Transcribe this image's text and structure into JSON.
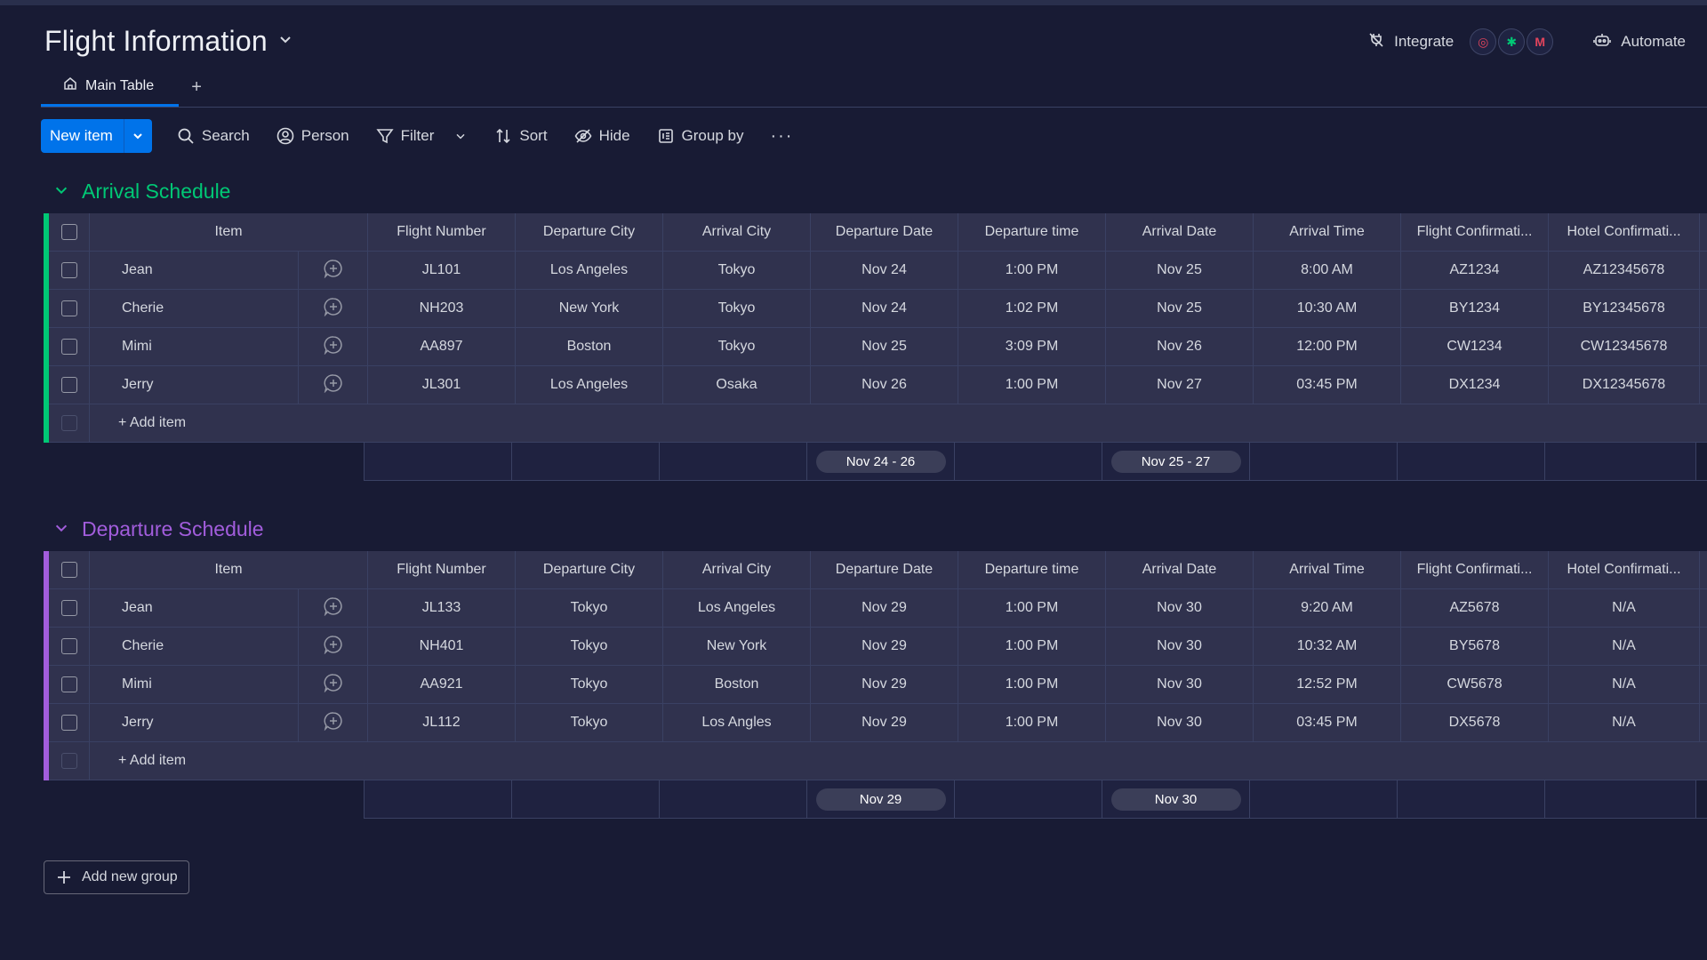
{
  "board": {
    "title": "Flight Information"
  },
  "header": {
    "integrate_label": "Integrate",
    "integrations": [
      {
        "icon": "integration-a-icon",
        "color": "#e2445c"
      },
      {
        "icon": "slack-icon",
        "color": "#00c875"
      },
      {
        "icon": "gmail-icon",
        "color": "#e2445c"
      }
    ],
    "automate_label": "Automate"
  },
  "tabs": [
    {
      "label": "Main Table",
      "active": true
    }
  ],
  "toolbar": {
    "new_item": "New item",
    "search": "Search",
    "person": "Person",
    "filter": "Filter",
    "sort": "Sort",
    "hide": "Hide",
    "group_by": "Group by"
  },
  "columns": [
    "Item",
    "Flight Number",
    "Departure City",
    "Arrival City",
    "Departure Date",
    "Departure time",
    "Arrival Date",
    "Arrival Time",
    "Flight Confirmati...",
    "Hotel Confirmati..."
  ],
  "add_item_label": "+ Add item",
  "groups": [
    {
      "title": "Arrival Schedule",
      "color": "#00c875",
      "rows": [
        {
          "item": "Jean",
          "flight": "JL101",
          "dep_city": "Los Angeles",
          "arr_city": "Tokyo",
          "dep_date": "Nov 24",
          "dep_time": "1:00 PM",
          "arr_date": "Nov 25",
          "arr_time": "8:00 AM",
          "flight_conf": "AZ1234",
          "hotel_conf": "AZ12345678"
        },
        {
          "item": "Cherie",
          "flight": "NH203",
          "dep_city": "New York",
          "arr_city": "Tokyo",
          "dep_date": "Nov 24",
          "dep_time": "1:02 PM",
          "arr_date": "Nov 25",
          "arr_time": "10:30 AM",
          "flight_conf": "BY1234",
          "hotel_conf": "BY12345678"
        },
        {
          "item": "Mimi",
          "flight": "AA897",
          "dep_city": "Boston",
          "arr_city": "Tokyo",
          "dep_date": "Nov 25",
          "dep_time": "3:09 PM",
          "arr_date": "Nov 26",
          "arr_time": "12:00 PM",
          "flight_conf": "CW1234",
          "hotel_conf": "CW12345678"
        },
        {
          "item": "Jerry",
          "flight": "JL301",
          "dep_city": "Los Angeles",
          "arr_city": "Osaka",
          "dep_date": "Nov 26",
          "dep_time": "1:00 PM",
          "arr_date": "Nov 27",
          "arr_time": "03:45 PM",
          "flight_conf": "DX1234",
          "hotel_conf": "DX12345678"
        }
      ],
      "summary": {
        "dep_date": "Nov 24 - 26",
        "arr_date": "Nov 25 - 27"
      }
    },
    {
      "title": "Departure Schedule",
      "color": "#a25ddc",
      "rows": [
        {
          "item": "Jean",
          "flight": "JL133",
          "dep_city": "Tokyo",
          "arr_city": "Los Angeles",
          "dep_date": "Nov 29",
          "dep_time": "1:00 PM",
          "arr_date": "Nov 30",
          "arr_time": "9:20 AM",
          "flight_conf": "AZ5678",
          "hotel_conf": "N/A"
        },
        {
          "item": "Cherie",
          "flight": "NH401",
          "dep_city": "Tokyo",
          "arr_city": "New York",
          "dep_date": "Nov 29",
          "dep_time": "1:00 PM",
          "arr_date": "Nov 30",
          "arr_time": "10:32 AM",
          "flight_conf": "BY5678",
          "hotel_conf": "N/A"
        },
        {
          "item": "Mimi",
          "flight": "AA921",
          "dep_city": "Tokyo",
          "arr_city": "Boston",
          "dep_date": "Nov 29",
          "dep_time": "1:00 PM",
          "arr_date": "Nov 30",
          "arr_time": "12:52 PM",
          "flight_conf": "CW5678",
          "hotel_conf": "N/A"
        },
        {
          "item": "Jerry",
          "flight": "JL112",
          "dep_city": "Tokyo",
          "arr_city": "Los Angles",
          "dep_date": "Nov 29",
          "dep_time": "1:00 PM",
          "arr_date": "Nov 30",
          "arr_time": "03:45 PM",
          "flight_conf": "DX5678",
          "hotel_conf": "N/A"
        }
      ],
      "summary": {
        "dep_date": "Nov 29",
        "arr_date": "Nov 30"
      }
    }
  ],
  "add_group_label": "Add new group"
}
